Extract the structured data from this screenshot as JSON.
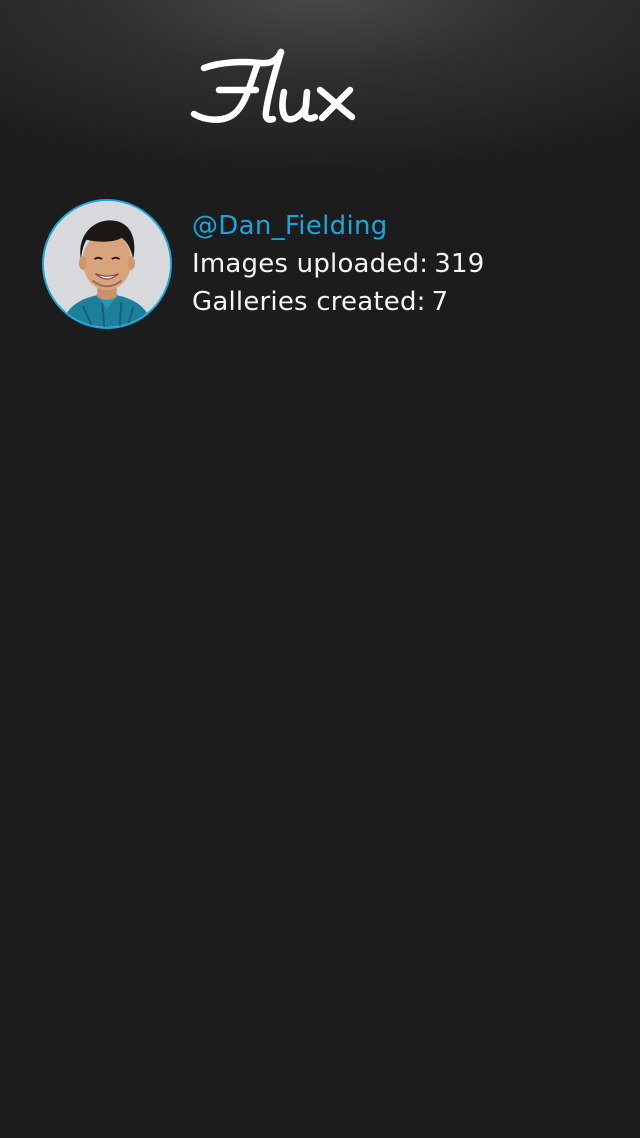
{
  "app": {
    "logo_text": "flux",
    "accent_color": "#1aa6dc",
    "background_color": "#1b1b1b"
  },
  "profile": {
    "avatar_icon": "user-avatar",
    "username": "@Dan_Fielding",
    "images_uploaded_label": "Images uploaded:",
    "images_uploaded_value": "319",
    "galleries_created_label": "Galleries created:",
    "galleries_created_value": "7"
  }
}
